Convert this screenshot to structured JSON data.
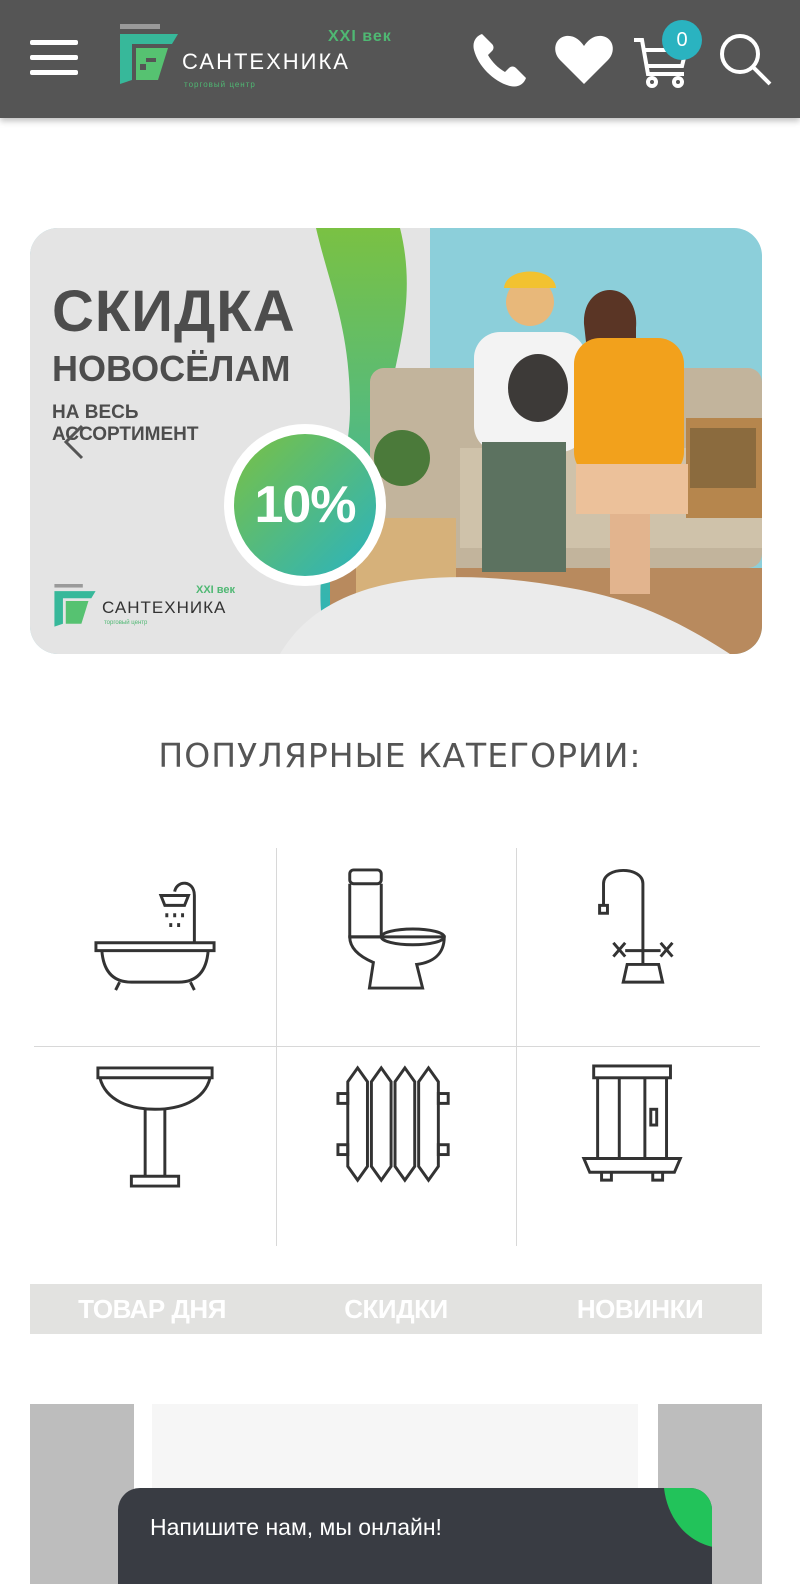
{
  "header": {
    "logo": {
      "brand": "САНТЕХНИКА",
      "edition": "XXI век",
      "tagline": "торговый центр"
    },
    "cart_count": "0"
  },
  "banner": {
    "headline": "СКИДКА",
    "subheadline": "НОВОСЁЛАМ",
    "line1": "НА ВЕСЬ",
    "line2": "АССОРТИМЕНТ",
    "discount": "10%",
    "logo": {
      "brand": "САНТЕХНИКА",
      "edition": "XXI век",
      "tagline": "торговый центр"
    }
  },
  "popular": {
    "title": "ПОПУЛЯРНЫЕ КАТЕГОРИИ:",
    "categories": [
      {
        "icon": "bathtub-icon"
      },
      {
        "icon": "toilet-icon"
      },
      {
        "icon": "faucet-icon"
      },
      {
        "icon": "sink-icon"
      },
      {
        "icon": "radiator-icon"
      },
      {
        "icon": "shower-cabin-icon"
      }
    ]
  },
  "tabs": [
    {
      "label": "ТОВАР ДНЯ"
    },
    {
      "label": "СКИДКИ"
    },
    {
      "label": "НОВИНКИ"
    }
  ],
  "chat": {
    "label": "Напишите нам, мы онлайн!"
  },
  "colors": {
    "header_bg": "#555555",
    "accent_green": "#4fb873",
    "accent_teal": "#2ab3c0",
    "tab_bg": "#e2e2e0",
    "chat_bg": "#393c43"
  }
}
